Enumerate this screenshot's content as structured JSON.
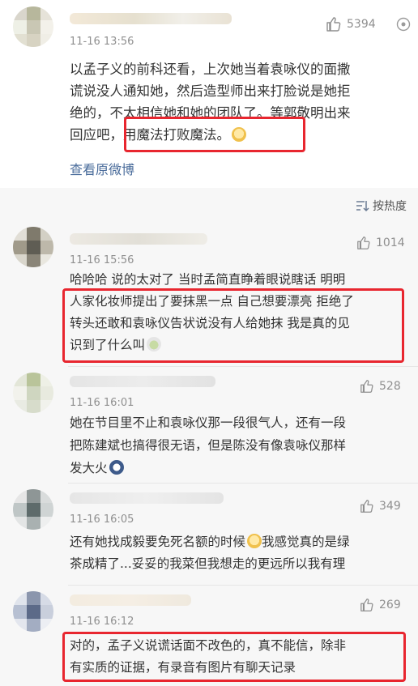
{
  "post": {
    "time": "11-16 13:56",
    "likes": "5394",
    "lines": [
      "以孟子义的前科还看，上次她当着袁咏仪的面撒",
      "谎说没人通知她，然后造型师出来打脸说是她拒",
      "绝的，不太相信她和她的团队了。等郭敬明出来",
      "回应吧，"
    ],
    "highlight": "用魔法打败魔法。",
    "view_original": "查看原微博"
  },
  "sort": {
    "label": "按热度"
  },
  "comments": [
    {
      "time": "11-16 15:56",
      "likes": "1014",
      "lines": [
        "哈哈哈 说的太对了 当时孟简直睁着眼说瞎话 明明",
        "人家化妆师提出了要抹黑一点 自己想要漂亮 拒绝了",
        "转头还敢和袁咏仪告状说没有人给她抹 我是真的见",
        "识到了什么叫"
      ]
    },
    {
      "time": "11-16 16:01",
      "likes": "528",
      "lines": [
        "她在节目里不止和袁咏仪那一段很气人，还有一段",
        "把陈建斌也搞得很无语，但是陈没有像袁咏仪那样",
        "发大火"
      ]
    },
    {
      "time": "11-16 16:05",
      "likes": "349",
      "lines": [
        "还有她找成毅要免死名额的时候",
        "我感觉真的是绿",
        "茶成精了...妥妥的我菜但我想走的更远所以我有理"
      ]
    },
    {
      "time": "11-16 16:12",
      "likes": "269",
      "lines": [
        "对的，孟子义说谎话面不改色的，真不能信，除非",
        "有实质的证据，有录音有图片有聊天记录"
      ]
    }
  ],
  "colors": {
    "highlight_border": "#e8262f",
    "link": "#4a6c9b",
    "muted": "#8f8f8f",
    "text": "#333333",
    "section_bg": "#f7f7f7"
  },
  "icons": [
    "thumbs-up-icon",
    "share-icon",
    "sort-icon",
    "emoji-icon"
  ]
}
